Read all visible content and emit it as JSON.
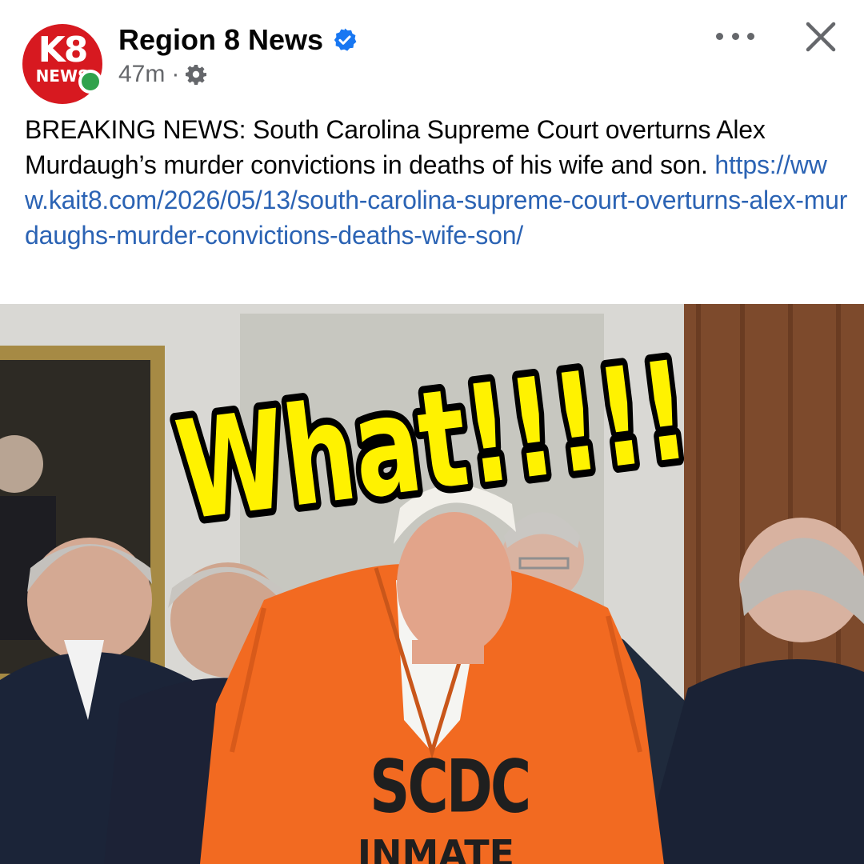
{
  "post": {
    "page_name": "Region 8 News",
    "avatar_text_top": "K8",
    "avatar_text_bottom": "NEWS",
    "time": "47m",
    "separator": "·",
    "audience_icon": "gear-icon",
    "verified_icon": "verified-badge-icon",
    "more_icon": "more-options-icon",
    "close_icon": "close-icon",
    "body_text": "BREAKING NEWS: South Carolina Supreme Court overturns Alex Murdaugh’s murder convictions in deaths of his wife and son.",
    "link_text": "https://www.kait8.com/2026/05/13/south-carolina-supreme-court-overturns-alex-murdaughs-murder-convictions-deaths-wife-son/"
  },
  "image": {
    "overlay_caption": "What!!!!!",
    "jumpsuit_text": "SCDC",
    "jumpsuit_text_lower": "INMATE"
  },
  "colors": {
    "link": "#2b63b4",
    "brand_red": "#d71920",
    "verified": "#1877f2",
    "online": "#31a24c",
    "overlay_yellow": "#fff200",
    "jumpsuit_orange": "#f26a21"
  }
}
